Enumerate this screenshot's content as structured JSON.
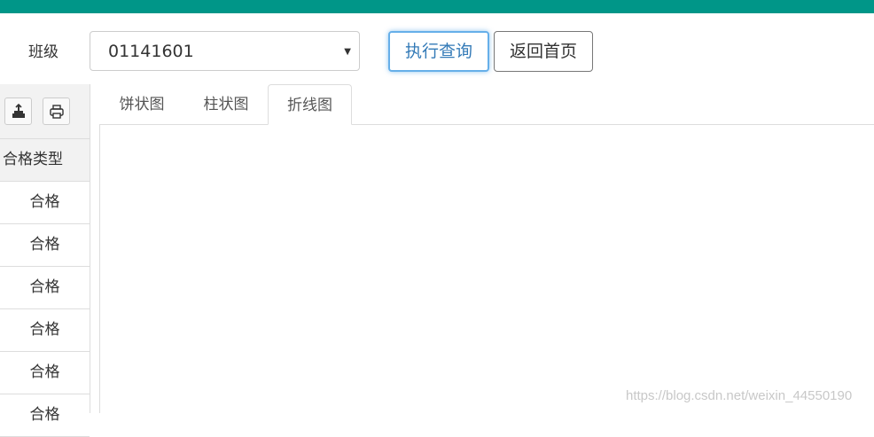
{
  "colors": {
    "topbar": "#009688",
    "focus_border": "#66afe9"
  },
  "filter": {
    "class_label": "班级",
    "class_value": "01141601",
    "query_button": "执行查询",
    "home_button": "返回首页"
  },
  "table": {
    "toolbar_icons": [
      "export-icon",
      "print-icon"
    ],
    "column_header": "合格类型",
    "rows": [
      "合格",
      "合格",
      "合格",
      "合格",
      "合格",
      "合格"
    ]
  },
  "tabs": [
    {
      "label": "饼状图",
      "active": false
    },
    {
      "label": "柱状图",
      "active": false
    },
    {
      "label": "折线图",
      "active": true
    }
  ],
  "watermark": "https://blog.csdn.net/weixin_44550190"
}
